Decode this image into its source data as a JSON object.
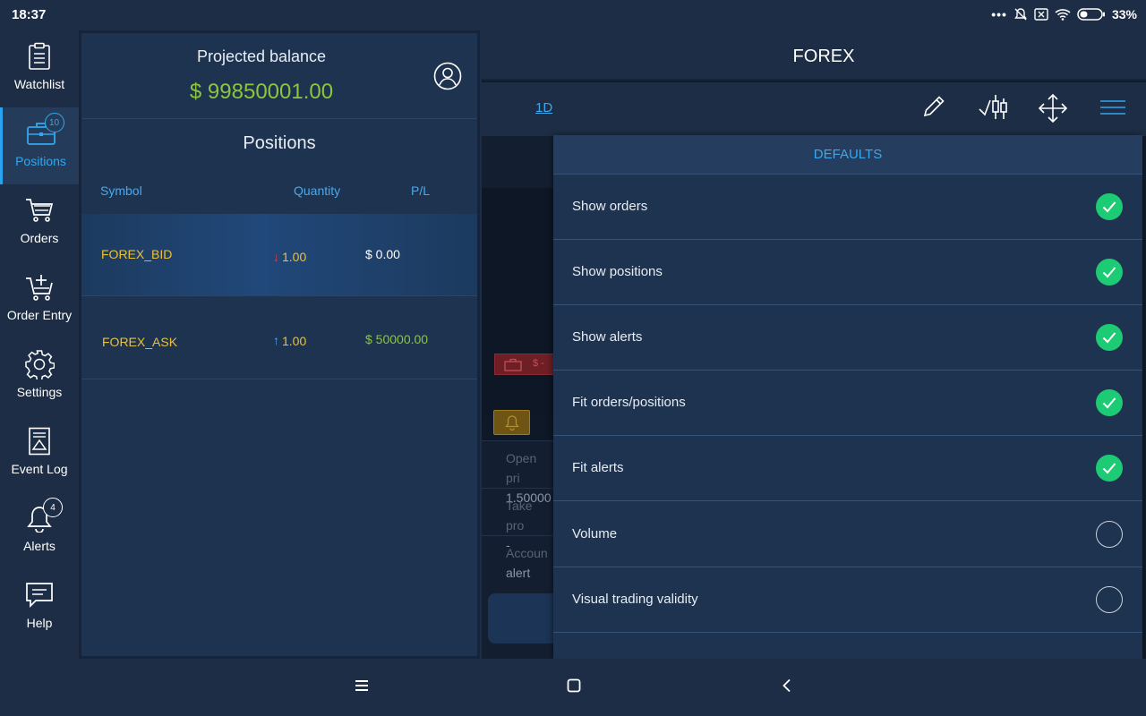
{
  "status_bar": {
    "time": "18:37",
    "battery": "33%"
  },
  "nav": {
    "items": [
      {
        "label": "Watchlist",
        "icon": "watchlist-icon"
      },
      {
        "label": "Positions",
        "icon": "briefcase-icon",
        "badge": "10",
        "active": true
      },
      {
        "label": "Orders",
        "icon": "cart-icon"
      },
      {
        "label": "Order Entry",
        "icon": "cart-plus-icon"
      },
      {
        "label": "Settings",
        "icon": "gear-icon"
      },
      {
        "label": "Event Log",
        "icon": "event-log-icon"
      },
      {
        "label": "Alerts",
        "icon": "bell-icon",
        "badge": "4"
      },
      {
        "label": "Help",
        "icon": "help-icon"
      }
    ]
  },
  "positions_panel": {
    "balance_label": "Projected balance",
    "balance_value": "$ 99850001.00",
    "title": "Positions",
    "columns": {
      "symbol": "Symbol",
      "quantity": "Quantity",
      "pl": "P/L"
    },
    "rows": [
      {
        "symbol": "FOREX_BID",
        "direction": "down",
        "arrow": "↓",
        "quantity": "1.00",
        "pl": "$ 0.00"
      },
      {
        "symbol": "FOREX_ASK",
        "direction": "up",
        "arrow": "↑",
        "quantity": "1.00",
        "pl": "$ 50000.00"
      }
    ]
  },
  "chart": {
    "title": "FOREX",
    "timeframe": "1D",
    "toolbar_icons": [
      "pencil-icon",
      "chart-type-icon",
      "move-icon",
      "menu-icon"
    ],
    "info_cells": [
      {
        "label": "Open pri",
        "value": "1.50000"
      },
      {
        "label": "Take pro",
        "value": "-"
      },
      {
        "label": "Accoun",
        "value": "alert"
      }
    ],
    "tag_text": "$ -"
  },
  "defaults": {
    "title": "DEFAULTS",
    "options": [
      {
        "label": "Show orders",
        "checked": true
      },
      {
        "label": "Show positions",
        "checked": true
      },
      {
        "label": "Show alerts",
        "checked": true
      },
      {
        "label": "Fit orders/positions",
        "checked": true
      },
      {
        "label": "Fit alerts",
        "checked": true
      },
      {
        "label": "Volume",
        "checked": false
      },
      {
        "label": "Visual trading validity",
        "checked": false
      }
    ]
  },
  "colors": {
    "accent": "#33a7ee",
    "positive": "#8cc63e",
    "symbol": "#e9c23a",
    "check_on": "#1ecb75",
    "background": "#1c2d45"
  }
}
